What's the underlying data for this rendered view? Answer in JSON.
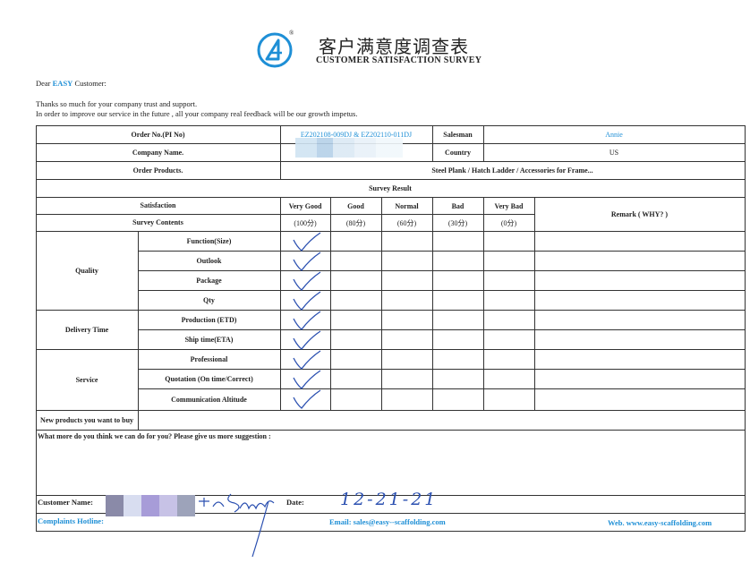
{
  "header": {
    "title_cn": "客户满意度调查表",
    "title_en": "CUSTOMER SATISFACTION SURVEY",
    "logo_icon": "easy-a-logo-icon",
    "registered_mark": "®"
  },
  "greeting": {
    "prefix": "Dear ",
    "brand": "EASY",
    "suffix": " Customer:"
  },
  "intro": {
    "line1": "Thanks so much for your company trust and support.",
    "line2": "In order to improve our service in the future , all your company real feedback will be our growth impetus."
  },
  "order": {
    "order_no_label": "Order No.(PI No)",
    "order_no_value": "EZ202108-009DJ & EZ202110-011DJ",
    "salesman_label": "Salesman",
    "salesman_value": "Annie",
    "company_label": "Company Name.",
    "country_label": "Country",
    "country_value": "US",
    "products_label": "Order Products.",
    "products_value": "Steel Plank  / Hatch Ladder / Accessories for Frame..."
  },
  "survey": {
    "result_label": "Survey Result",
    "satisfaction_label": "Satisfaction",
    "contents_label": "Survey Contents",
    "remark_label": "Remark ( WHY? )",
    "ratings": [
      {
        "name": "Very Good",
        "score": "(100分)"
      },
      {
        "name": "Good",
        "score": "(80分)"
      },
      {
        "name": "Normal",
        "score": "(60分)"
      },
      {
        "name": "Bad",
        "score": "(30分)"
      },
      {
        "name": "Very Bad",
        "score": "(0分)"
      }
    ],
    "groups": [
      {
        "name": "Quality",
        "items": [
          "Function(Size)",
          "Outlook",
          "Package",
          "Qty"
        ]
      },
      {
        "name": "Delivery Time",
        "items": [
          "Production (ETD)",
          "Ship time(ETA)"
        ]
      },
      {
        "name": "Service",
        "items": [
          "Professional",
          "Quotation (On time/Correct)",
          "Communication Altitude"
        ]
      }
    ],
    "new_products_label": "New products you want to buy",
    "suggestion_label": "What more do you think we can do for you? Please give us more suggestion :"
  },
  "footer": {
    "customer_name_label": "Customer Name:",
    "date_label": "Date:",
    "date_value": "12-21-21",
    "complaints_label": "Complaints Hotline:",
    "email": "Email:  sales@easy--scaffolding.com",
    "web": "Web.  www.easy-scaffolding.com"
  },
  "colors": {
    "accent": "#1e8fd6",
    "ink": "#2a4fb0",
    "line": "#333333"
  }
}
